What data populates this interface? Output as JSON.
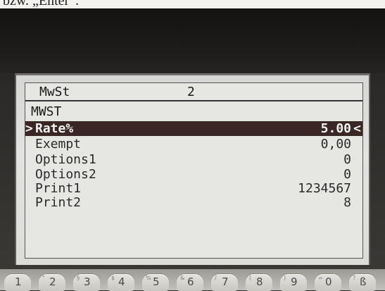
{
  "caption": "bzw. „Enter“.",
  "header": {
    "menu_label": "MwSt",
    "menu_number": "2"
  },
  "section": {
    "title": "MWST"
  },
  "selection_cursor": {
    "left": ">",
    "right": "<"
  },
  "items": [
    {
      "label": "Rate%",
      "value": "5.00",
      "selected": true
    },
    {
      "label": "Exempt",
      "value": "0,00",
      "selected": false
    },
    {
      "label": "Options1",
      "value": "0",
      "selected": false
    },
    {
      "label": "Options2",
      "value": "0",
      "selected": false
    },
    {
      "label": "Print1",
      "value": "1234567",
      "selected": false
    },
    {
      "label": "Print2",
      "value": "8",
      "selected": false
    }
  ],
  "keys": [
    {
      "main": "1",
      "sub": ""
    },
    {
      "main": "2",
      "sub": "\""
    },
    {
      "main": "3",
      "sub": "§"
    },
    {
      "main": "4",
      "sub": "$"
    },
    {
      "main": "5",
      "sub": "%"
    },
    {
      "main": "6",
      "sub": "&"
    },
    {
      "main": "7",
      "sub": "/"
    },
    {
      "main": "8",
      "sub": "("
    },
    {
      "main": "9",
      "sub": ")"
    },
    {
      "main": "0",
      "sub": "="
    },
    {
      "main": "ß",
      "sub": "?"
    }
  ],
  "colors": {
    "bezel": "#2c2a28",
    "lcd_background": "#e2e3e0",
    "selection_bar": "#3a2623",
    "lcd_text": "#1a1a1a"
  }
}
